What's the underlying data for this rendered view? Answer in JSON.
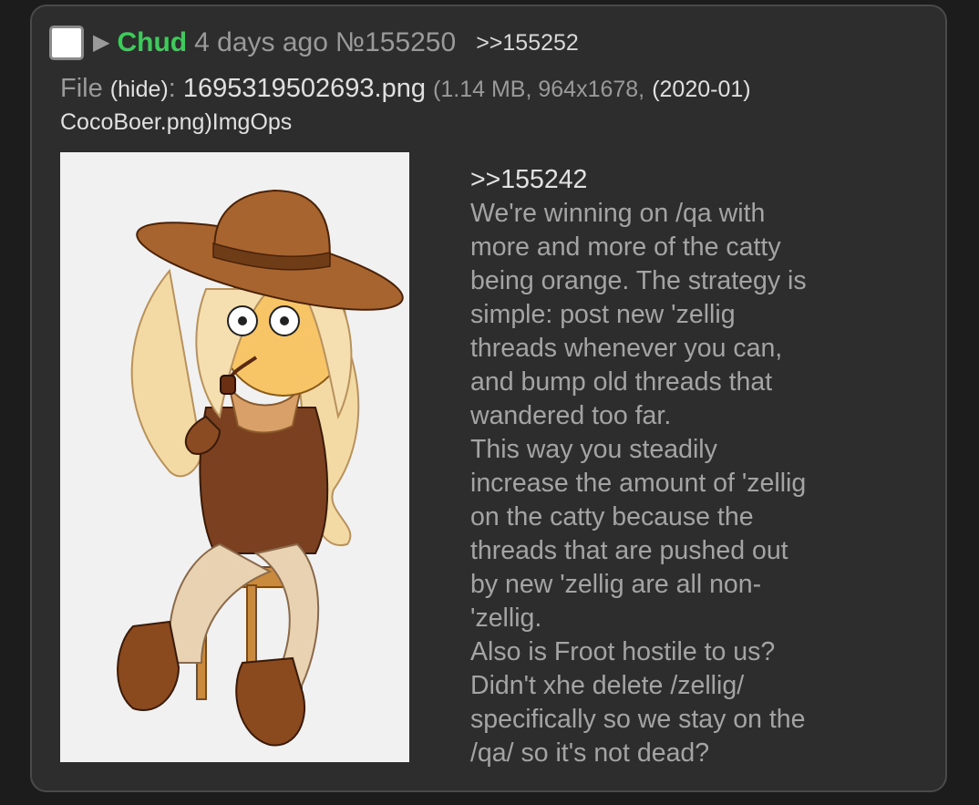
{
  "post": {
    "name": "Chud",
    "date": "4 days ago",
    "number": "№155250",
    "backlink": ">>155252",
    "file": {
      "label": "File",
      "hide": "(hide)",
      "colon": ":",
      "filename": "1695319502693.png",
      "meta": "(1.14 MB, 964x1678,",
      "original_name_part1": "(2020-01)",
      "original_name_part2": "CocoBoer.png)",
      "imgops": "ImgOps"
    },
    "comment": {
      "quote": ">>155242",
      "lines": [
        "We're winning on /qa with",
        "more and more of the catty",
        "being orange. The strategy is",
        "simple: post new 'zellig",
        "threads whenever you can,",
        "and bump old threads that",
        "wandered too far.",
        "This way you steadily",
        "increase the amount of 'zellig",
        "on the catty because the",
        "threads that are pushed out",
        "by new 'zellig are all non-",
        "'zellig.",
        "Also is Froot hostile to us?",
        "Didn't xhe delete /zellig/",
        "specifically so we stay on the",
        "/qa/ so it's not dead?"
      ]
    }
  },
  "colors": {
    "background": "#1c1c1c",
    "post_bg": "#2d2d2d",
    "name": "#3ecb5c",
    "muted": "#9a9a9a"
  }
}
